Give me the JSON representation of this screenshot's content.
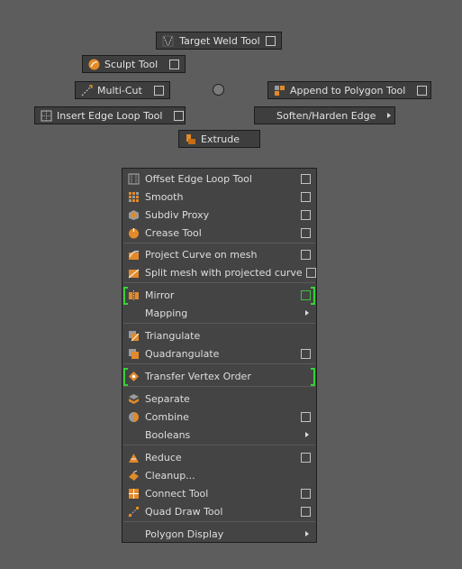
{
  "marking_menu": {
    "north": {
      "label": "Target Weld Tool",
      "icon": "target-weld-icon",
      "has_option_box": true
    },
    "northwest": {
      "label": "Sculpt Tool",
      "icon": "sculpt-icon",
      "has_option_box": true
    },
    "west": {
      "label": "Multi-Cut",
      "icon": "multi-cut-icon",
      "has_option_box": true
    },
    "east": {
      "label": "Append to Polygon Tool",
      "icon": "append-polygon-icon",
      "has_option_box": true
    },
    "southwest": {
      "label": "Insert Edge Loop Tool",
      "icon": "insert-edge-loop-icon",
      "has_option_box": true
    },
    "southeast": {
      "label": "Soften/Harden Edge",
      "has_submenu": true
    },
    "south": {
      "label": "Extrude",
      "icon": "extrude-icon"
    }
  },
  "overflow_menu": {
    "items": [
      {
        "label": "Offset Edge Loop Tool",
        "icon": "offset-edge-loop-icon",
        "option_box": true
      },
      {
        "label": "Smooth",
        "icon": "smooth-icon",
        "option_box": true
      },
      {
        "label": "Subdiv Proxy",
        "icon": "subdiv-proxy-icon",
        "option_box": true
      },
      {
        "label": "Crease Tool",
        "icon": "crease-icon",
        "option_box": true
      },
      {
        "label": "Project Curve on mesh",
        "icon": "project-curve-icon",
        "option_box": true
      },
      {
        "label": "Split mesh with projected curve",
        "icon": "split-mesh-icon",
        "option_box": true
      },
      {
        "label": "Mirror",
        "icon": "mirror-icon",
        "option_box": true,
        "highlighted": true
      },
      {
        "label": "Mapping",
        "submenu": true
      },
      {
        "label": "Triangulate",
        "icon": "triangulate-icon"
      },
      {
        "label": "Quadrangulate",
        "icon": "quadrangulate-icon",
        "option_box": true
      },
      {
        "label": "Transfer Vertex Order",
        "icon": "transfer-vertex-order-icon",
        "highlighted": true
      },
      {
        "label": "Separate",
        "icon": "separate-icon"
      },
      {
        "label": "Combine",
        "icon": "combine-icon",
        "option_box": true
      },
      {
        "label": "Booleans",
        "submenu": true
      },
      {
        "label": "Reduce",
        "icon": "reduce-icon",
        "option_box": true
      },
      {
        "label": "Cleanup...",
        "icon": "cleanup-icon"
      },
      {
        "label": "Connect Tool",
        "icon": "connect-icon",
        "option_box": true
      },
      {
        "label": "Quad Draw Tool",
        "icon": "quad-draw-icon",
        "option_box": true
      },
      {
        "label": "Polygon Display",
        "submenu": true
      }
    ]
  },
  "colors": {
    "accent_orange": "#e28a2a",
    "highlight_green": "#36d236",
    "menu_bg": "#444444",
    "viewport_bg": "#5d5d5d"
  }
}
